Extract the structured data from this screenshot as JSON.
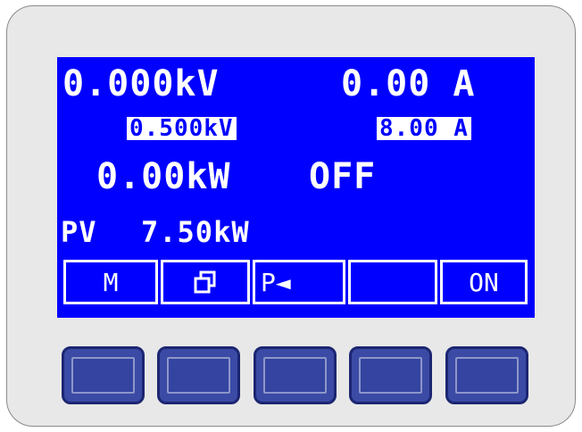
{
  "display": {
    "voltage_actual": "0.000kV",
    "current_actual": "0.00 A",
    "voltage_set": "0.500kV",
    "current_set": "8.00 A",
    "power_actual": "0.00kW",
    "output_state": "OFF",
    "power_label": "PV",
    "power_set": "7.50kW"
  },
  "softkeys": [
    {
      "label": "M",
      "icon": "mode"
    },
    {
      "label": "",
      "icon": "overlapping-squares-icon"
    },
    {
      "label": "P◄",
      "icon": "profile-arrow"
    },
    {
      "label": "",
      "icon": "empty"
    },
    {
      "label": "ON",
      "icon": "output-on"
    }
  ],
  "colors": {
    "screen": "#0000ff",
    "text": "#ffffff",
    "button_fill": "#3b4aa5",
    "panel": "#e8e8e8"
  }
}
